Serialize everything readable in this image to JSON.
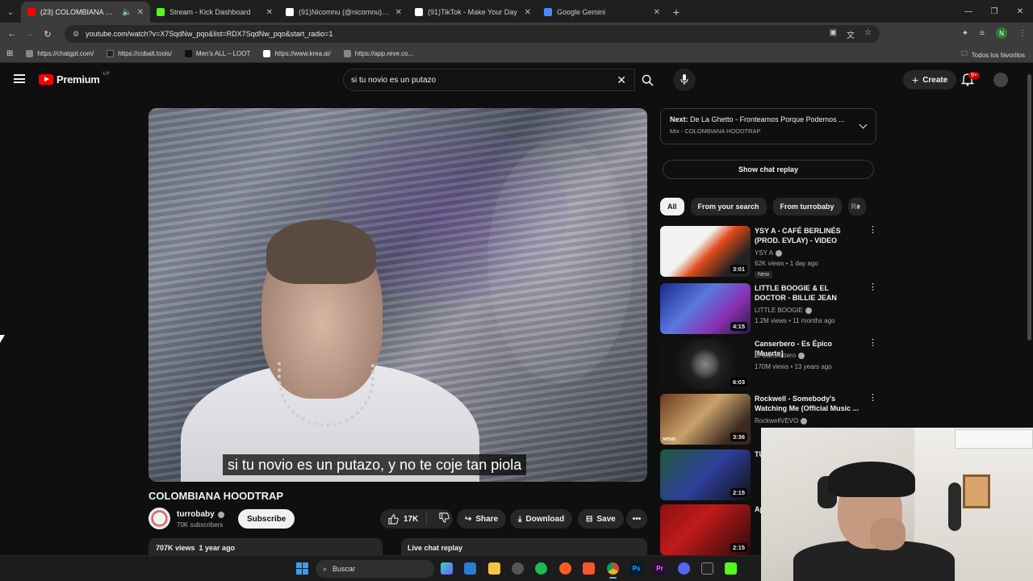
{
  "browser": {
    "tabs": [
      {
        "title": "(23) COLOMBIANA HOODTRAP",
        "favicon_color": "#ff0000",
        "active": true
      },
      {
        "title": "Stream - Kick Dashboard",
        "favicon_color": "#53fc18",
        "active": false
      },
      {
        "title": "(91)Nicomnu (@nicomnu) | TikTok",
        "favicon_color": "#ffffff",
        "active": false
      },
      {
        "title": "(91)TikTok - Make Your Day",
        "favicon_color": "#ffffff",
        "active": false
      },
      {
        "title": "Google Gemini",
        "favicon_color": "#4a8cf7",
        "active": false
      }
    ],
    "url": "youtube.com/watch?v=X7SqdNw_pqo&list=RDX7SqdNw_pqo&start_radio=1",
    "profile_initial": "N",
    "bookmarks": [
      "https://chatgpt.com/",
      "https://cobalt.tools/",
      "Men's ALL – LOOT",
      "https://www.krea.ai/",
      "https://app.reve.co..."
    ],
    "all_bookmarks_label": "Todos los favoritos"
  },
  "youtube": {
    "logo_text": "Premium",
    "country_code": "UY",
    "search_query": "si tu novio es un putazo",
    "create_label": "Create",
    "notifications_badge": "9+"
  },
  "video": {
    "caption": "si tu novio es un putazo, y no te coje tan piola",
    "title": "COLOMBIANA HOODTRAP",
    "channel": "turrobaby",
    "subscribers": "70K subscribers",
    "subscribe_label": "Subscribe",
    "likes": "17K",
    "share_label": "Share",
    "download_label": "Download",
    "save_label": "Save",
    "views_date": "707K views  1 year ago",
    "live_chat_label": "Live chat replay"
  },
  "sidebar": {
    "next_prefix": "Next:",
    "next_title": "De La Ghetto - Fronteamos Porque Podemos ...",
    "next_mix": "Mix - COLOMBIANA HOODTRAP",
    "show_chat_replay": "Show chat replay",
    "chips": [
      "All",
      "From your search",
      "From turrobaby",
      "Re"
    ],
    "recommendations": [
      {
        "title": "YSY A - CAFÉ BERLINÉS (PROD. EVLAY) - VIDEO OFICIAL -",
        "channel": "YSY A",
        "meta": "62K views • 1 day ago",
        "badge": "New",
        "duration": "3:01"
      },
      {
        "title": "LITTLE BOOGIE & EL DOCTOR - BILLIE JEAN (VIDEOCLIP ...",
        "channel": "LITTLE BOOGIE",
        "meta": "1.2M views • 11 months ago",
        "duration": "4:15"
      },
      {
        "title": "Canserbero - Es Épico [Muerte]",
        "channel": "El Canserbero",
        "meta": "170M views • 13 years ago",
        "duration": "6:03"
      },
      {
        "title": "Rockwell - Somebody's Watching Me (Official Music ...",
        "channel": "RockwellVEVO",
        "meta": "",
        "duration": "3:36"
      },
      {
        "title": "TU",
        "channel": "",
        "meta": "",
        "duration": "2:15"
      },
      {
        "title": "Ap",
        "channel": "",
        "meta": "",
        "duration": "2:15"
      }
    ]
  },
  "taskbar": {
    "search_label": "Buscar"
  }
}
